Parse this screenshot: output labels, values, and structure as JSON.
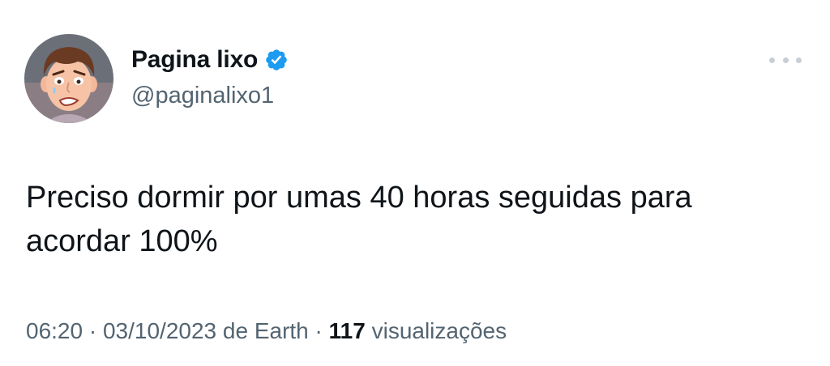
{
  "author": {
    "display_name": "Pagina lixo",
    "handle": "@paginalixo1",
    "verified": true,
    "avatar_icon": "cartoon-face-avatar"
  },
  "tweet": {
    "text": "Preciso dormir por umas 40 horas seguidas para acordar 100%",
    "time": "06:20",
    "separator": "·",
    "date": "03/10/2023",
    "source": "de Earth",
    "views_count": "117",
    "views_label": "visualizações"
  },
  "colors": {
    "primary_text": "#0f1419",
    "secondary_text": "#536471",
    "verified_blue": "#1d9bf0",
    "more_dots": "#c7ced4"
  },
  "icons": {
    "verified": "verified-badge-icon",
    "more": "more-options-icon"
  }
}
